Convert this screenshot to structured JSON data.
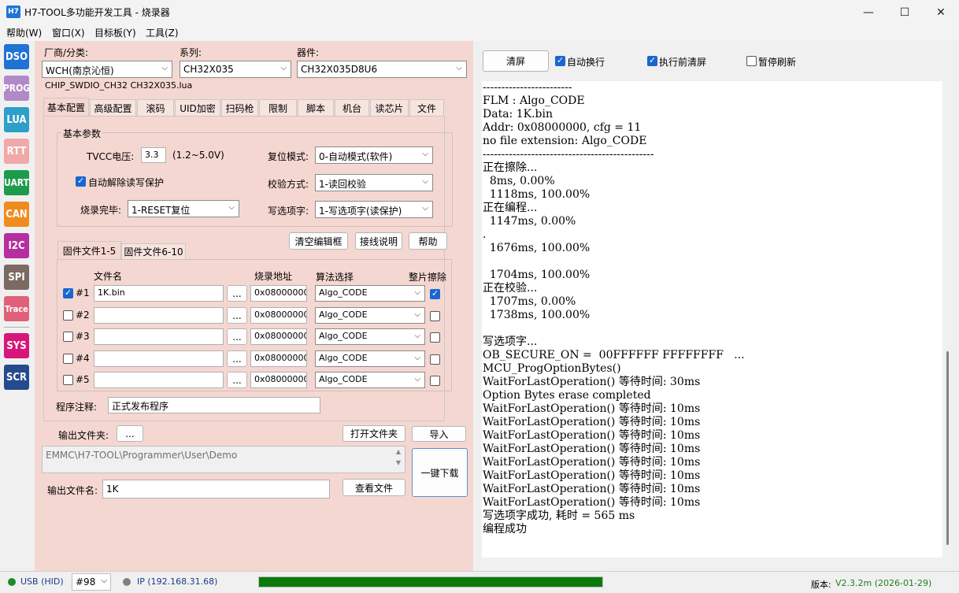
{
  "window": {
    "title": "H7-TOOL多功能开发工具 - 烧录器",
    "icon_text": "H7"
  },
  "menu": [
    "帮助(W)",
    "窗口(X)",
    "目标板(Y)",
    "工具(Z)"
  ],
  "sidebar": [
    {
      "label": "DSO",
      "color": "#1f73d2"
    },
    {
      "label": "PROG",
      "color": "#b089c6"
    },
    {
      "label": "LUA",
      "color": "#2e9fc9"
    },
    {
      "label": "RTT",
      "color": "#f0a8a8"
    },
    {
      "label": "UART",
      "color": "#1e9a4d"
    },
    {
      "label": "CAN",
      "color": "#f08c1e"
    },
    {
      "label": "I2C",
      "color": "#b62fa0"
    },
    {
      "label": "SPI",
      "color": "#7a6a62"
    },
    {
      "label": "Trace",
      "color": "#e0607a"
    },
    {
      "label": "SYS",
      "color": "#d8157a"
    },
    {
      "label": "SCR",
      "color": "#264a8e"
    }
  ],
  "chip": {
    "vendor_label": "厂商/分类:",
    "vendor_value": "WCH(南京沁恒)",
    "series_label": "系列:",
    "series_value": "CH32X035",
    "device_label": "器件:",
    "device_value": "CH32X035D8U6",
    "path_info": "CHIP_SWDIO_CH32  CH32X035.lua"
  },
  "tabs": [
    "基本配置",
    "高级配置",
    "滚码",
    "UID加密",
    "扫码枪",
    "限制",
    "脚本",
    "机台",
    "读芯片",
    "文件"
  ],
  "basic": {
    "group_title": "基本参数",
    "tvcc_label": "TVCC电压:",
    "tvcc_value": "3.3",
    "tvcc_range": "(1.2~5.0V)",
    "auto_unlock_label": "自动解除读写保护",
    "burn_done_label": "烧录完毕:",
    "burn_done_value": "1-RESET复位",
    "reset_mode_label": "复位模式:",
    "reset_mode_value": "0-自动模式(软件)",
    "verify_label": "校验方式:",
    "verify_value": "1-读回校验",
    "option_label": "写选项字:",
    "option_value": "1-写选项字(读保护)"
  },
  "buttons": {
    "clear_editor": "清空编辑框",
    "wiring": "接线说明",
    "help": "帮助",
    "browse": "...",
    "open_folder": "打开文件夹",
    "import": "导入",
    "view_file": "查看文件",
    "one_key_download": "一键下载",
    "clear": "清屏"
  },
  "firmware": {
    "tabs": [
      "固件文件1-5",
      "固件文件6-10"
    ],
    "headers": {
      "filename": "文件名",
      "address": "烧录地址",
      "algo": "算法选择",
      "erase": "整片擦除"
    },
    "rows": [
      {
        "id": "#1",
        "checked": true,
        "file": "1K.bin",
        "addr": "0x08000000",
        "algo": "Algo_CODE",
        "erase": true
      },
      {
        "id": "#2",
        "checked": false,
        "file": "",
        "addr": "0x08000000",
        "algo": "Algo_CODE",
        "erase": false
      },
      {
        "id": "#3",
        "checked": false,
        "file": "",
        "addr": "0x08000000",
        "algo": "Algo_CODE",
        "erase": false
      },
      {
        "id": "#4",
        "checked": false,
        "file": "",
        "addr": "0x08000000",
        "algo": "Algo_CODE",
        "erase": false
      },
      {
        "id": "#5",
        "checked": false,
        "file": "",
        "addr": "0x08000000",
        "algo": "Algo_CODE",
        "erase": false
      }
    ]
  },
  "note": {
    "label": "程序注释:",
    "value": "正式发布程序"
  },
  "output": {
    "folder_label": "输出文件夹:",
    "folder_path": "EMMC\\H7-TOOL\\Programmer\\User\\Demo",
    "filename_label": "输出文件名:",
    "filename_value": "1K"
  },
  "console_options": {
    "auto_wrap": "自动换行",
    "clear_before": "执行前清屏",
    "pause_refresh": "暂停刷新"
  },
  "console_lines": [
    "------------------------",
    "FLM : Algo_CODE",
    "Data: 1K.bin",
    "Addr: 0x08000000, cfg = 11",
    "no file extension: Algo_CODE",
    "----------------------------------------------",
    "正在擦除...",
    "  8ms, 0.00%",
    "  1118ms, 100.00%",
    "正在编程...",
    "  1147ms, 0.00%",
    ".",
    "  1676ms, 100.00%",
    "",
    "  1704ms, 100.00%",
    "正在校验...",
    "  1707ms, 0.00%",
    "  1738ms, 100.00%",
    "",
    "写选项字...",
    "OB_SECURE_ON =  00FFFFFF FFFFFFFF   ...",
    "MCU_ProgOptionBytes()",
    "WaitForLastOperation() 等待时间: 30ms",
    "Option Bytes erase completed",
    "WaitForLastOperation() 等待时间: 10ms",
    "WaitForLastOperation() 等待时间: 10ms",
    "WaitForLastOperation() 等待时间: 10ms",
    "WaitForLastOperation() 等待时间: 10ms",
    "WaitForLastOperation() 等待时间: 10ms",
    "WaitForLastOperation() 等待时间: 10ms",
    "WaitForLastOperation() 等待时间: 10ms",
    "WaitForLastOperation() 等待时间: 10ms",
    "写选项字成功, 耗时 = 565 ms",
    "编程成功"
  ],
  "status": {
    "usb": "USB (HID)",
    "device_num": "#98",
    "ip": "IP (192.168.31.68)",
    "progress": 1.0,
    "version_label": "版本:",
    "version_value": "V2.3.2m (2026-01-29)"
  }
}
